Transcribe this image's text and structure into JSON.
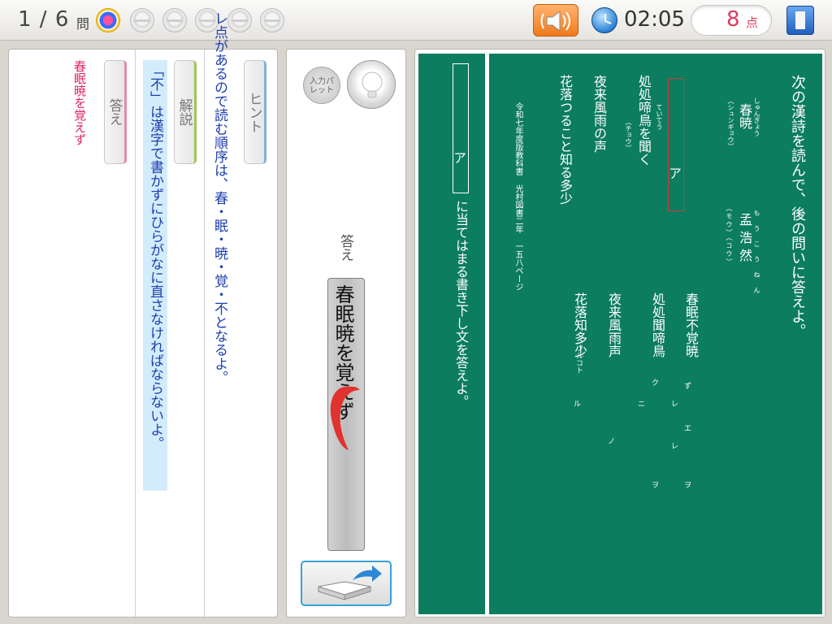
{
  "topbar": {
    "question_counter": "1 / 6",
    "question_label": "問",
    "progress_dots": [
      "active",
      "empty",
      "empty",
      "empty",
      "empty",
      "empty"
    ],
    "timer": "02:05",
    "score_value": "8",
    "score_unit": "点"
  },
  "left_panel": {
    "hint_tab": "ヒント",
    "hint_text": "レ点があるので読む順序は、春・眠・暁・覚・不となるよ。",
    "explanation_tab": "解説",
    "explanation_text": "「不」は漢字で書かずにひらがなに直さなければならないよ。",
    "answer_tab": "答え",
    "answer_text": "春眠暁を覚えず"
  },
  "middle_panel": {
    "palette_label": "入力パレット",
    "answer_label": "答え",
    "answer_input": "春眠暁を覚えず"
  },
  "board": {
    "answer_side": {
      "blank_label": "ア",
      "instruction": "に当てはまる書き下し文を答えよ。"
    },
    "question_side": {
      "instruction": "次の漢詩を読んで、後の問いに答えよ。",
      "title": "春暁",
      "title_ruby": "しゅんぎょう",
      "title_paren": "（シュンギョウ）",
      "author": "孟浩然",
      "author_ruby": "もうこうねん",
      "author_paren": "（モウ）（コウ）",
      "blank_label": "ア",
      "kundoku_lines": [
        "処処啼鳥を聞く",
        "夜来風雨の声",
        "花落つること知る多少"
      ],
      "teitei_ruby": "ていてう",
      "chou_paren": "（チョウ）",
      "source": "令和七年度版教科書 光村図書二年 一五八ページ",
      "kanbun_lines": [
        "春眠不覚暁",
        "処処聞啼鳥",
        "夜来風雨声",
        "花落知多少"
      ],
      "kanbun_marks": [
        "ず",
        "レ",
        "エ",
        "レ",
        "ヲ",
        "ニ",
        "ク",
        "ヲ",
        "ノ",
        "ツルコト",
        "ル"
      ]
    }
  },
  "colors": {
    "board": "#0c7d5f",
    "accent_red": "#e0245e",
    "hint_blue": "#1f3fb0",
    "explanation_bg": "#d3ecfb"
  }
}
